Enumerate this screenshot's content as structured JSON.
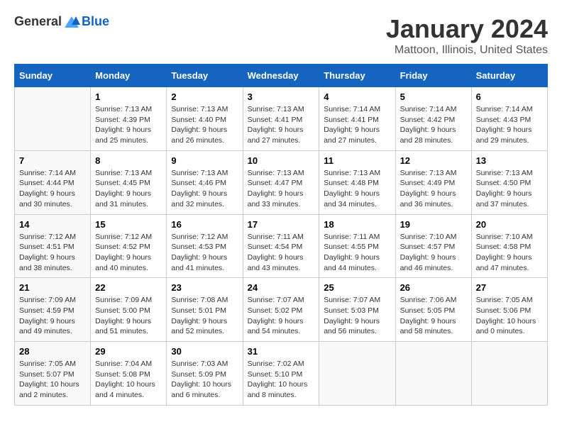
{
  "header": {
    "logo_general": "General",
    "logo_blue": "Blue",
    "title": "January 2024",
    "subtitle": "Mattoon, Illinois, United States"
  },
  "calendar": {
    "days_of_week": [
      "Sunday",
      "Monday",
      "Tuesday",
      "Wednesday",
      "Thursday",
      "Friday",
      "Saturday"
    ],
    "weeks": [
      [
        {
          "day": "",
          "info": ""
        },
        {
          "day": "1",
          "info": "Sunrise: 7:13 AM\nSunset: 4:39 PM\nDaylight: 9 hours\nand 25 minutes."
        },
        {
          "day": "2",
          "info": "Sunrise: 7:13 AM\nSunset: 4:40 PM\nDaylight: 9 hours\nand 26 minutes."
        },
        {
          "day": "3",
          "info": "Sunrise: 7:13 AM\nSunset: 4:41 PM\nDaylight: 9 hours\nand 27 minutes."
        },
        {
          "day": "4",
          "info": "Sunrise: 7:14 AM\nSunset: 4:41 PM\nDaylight: 9 hours\nand 27 minutes."
        },
        {
          "day": "5",
          "info": "Sunrise: 7:14 AM\nSunset: 4:42 PM\nDaylight: 9 hours\nand 28 minutes."
        },
        {
          "day": "6",
          "info": "Sunrise: 7:14 AM\nSunset: 4:43 PM\nDaylight: 9 hours\nand 29 minutes."
        }
      ],
      [
        {
          "day": "7",
          "info": "Sunrise: 7:14 AM\nSunset: 4:44 PM\nDaylight: 9 hours\nand 30 minutes."
        },
        {
          "day": "8",
          "info": "Sunrise: 7:13 AM\nSunset: 4:45 PM\nDaylight: 9 hours\nand 31 minutes."
        },
        {
          "day": "9",
          "info": "Sunrise: 7:13 AM\nSunset: 4:46 PM\nDaylight: 9 hours\nand 32 minutes."
        },
        {
          "day": "10",
          "info": "Sunrise: 7:13 AM\nSunset: 4:47 PM\nDaylight: 9 hours\nand 33 minutes."
        },
        {
          "day": "11",
          "info": "Sunrise: 7:13 AM\nSunset: 4:48 PM\nDaylight: 9 hours\nand 34 minutes."
        },
        {
          "day": "12",
          "info": "Sunrise: 7:13 AM\nSunset: 4:49 PM\nDaylight: 9 hours\nand 36 minutes."
        },
        {
          "day": "13",
          "info": "Sunrise: 7:13 AM\nSunset: 4:50 PM\nDaylight: 9 hours\nand 37 minutes."
        }
      ],
      [
        {
          "day": "14",
          "info": "Sunrise: 7:12 AM\nSunset: 4:51 PM\nDaylight: 9 hours\nand 38 minutes."
        },
        {
          "day": "15",
          "info": "Sunrise: 7:12 AM\nSunset: 4:52 PM\nDaylight: 9 hours\nand 40 minutes."
        },
        {
          "day": "16",
          "info": "Sunrise: 7:12 AM\nSunset: 4:53 PM\nDaylight: 9 hours\nand 41 minutes."
        },
        {
          "day": "17",
          "info": "Sunrise: 7:11 AM\nSunset: 4:54 PM\nDaylight: 9 hours\nand 43 minutes."
        },
        {
          "day": "18",
          "info": "Sunrise: 7:11 AM\nSunset: 4:55 PM\nDaylight: 9 hours\nand 44 minutes."
        },
        {
          "day": "19",
          "info": "Sunrise: 7:10 AM\nSunset: 4:57 PM\nDaylight: 9 hours\nand 46 minutes."
        },
        {
          "day": "20",
          "info": "Sunrise: 7:10 AM\nSunset: 4:58 PM\nDaylight: 9 hours\nand 47 minutes."
        }
      ],
      [
        {
          "day": "21",
          "info": "Sunrise: 7:09 AM\nSunset: 4:59 PM\nDaylight: 9 hours\nand 49 minutes."
        },
        {
          "day": "22",
          "info": "Sunrise: 7:09 AM\nSunset: 5:00 PM\nDaylight: 9 hours\nand 51 minutes."
        },
        {
          "day": "23",
          "info": "Sunrise: 7:08 AM\nSunset: 5:01 PM\nDaylight: 9 hours\nand 52 minutes."
        },
        {
          "day": "24",
          "info": "Sunrise: 7:07 AM\nSunset: 5:02 PM\nDaylight: 9 hours\nand 54 minutes."
        },
        {
          "day": "25",
          "info": "Sunrise: 7:07 AM\nSunset: 5:03 PM\nDaylight: 9 hours\nand 56 minutes."
        },
        {
          "day": "26",
          "info": "Sunrise: 7:06 AM\nSunset: 5:05 PM\nDaylight: 9 hours\nand 58 minutes."
        },
        {
          "day": "27",
          "info": "Sunrise: 7:05 AM\nSunset: 5:06 PM\nDaylight: 10 hours\nand 0 minutes."
        }
      ],
      [
        {
          "day": "28",
          "info": "Sunrise: 7:05 AM\nSunset: 5:07 PM\nDaylight: 10 hours\nand 2 minutes."
        },
        {
          "day": "29",
          "info": "Sunrise: 7:04 AM\nSunset: 5:08 PM\nDaylight: 10 hours\nand 4 minutes."
        },
        {
          "day": "30",
          "info": "Sunrise: 7:03 AM\nSunset: 5:09 PM\nDaylight: 10 hours\nand 6 minutes."
        },
        {
          "day": "31",
          "info": "Sunrise: 7:02 AM\nSunset: 5:10 PM\nDaylight: 10 hours\nand 8 minutes."
        },
        {
          "day": "",
          "info": ""
        },
        {
          "day": "",
          "info": ""
        },
        {
          "day": "",
          "info": ""
        }
      ]
    ]
  }
}
